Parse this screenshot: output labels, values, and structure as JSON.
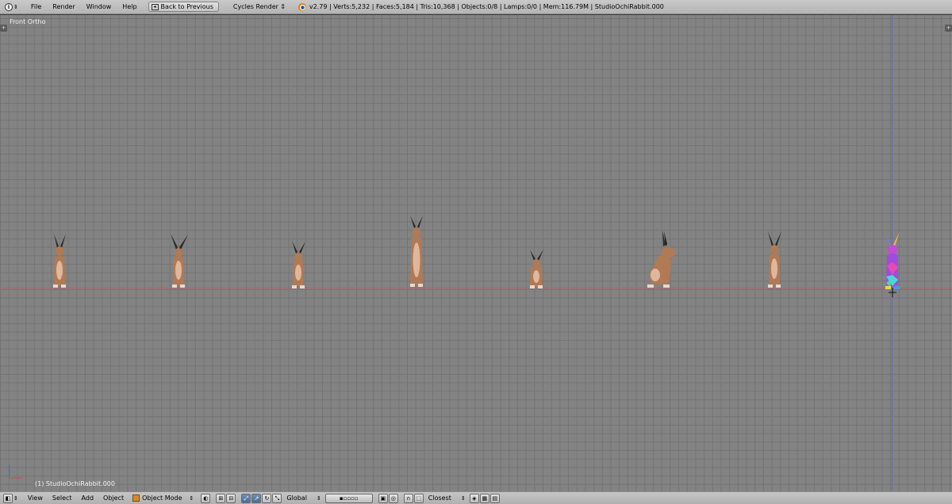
{
  "topbar": {
    "menus": [
      "File",
      "Render",
      "Window",
      "Help"
    ],
    "back_button": "Back to Previous",
    "render_engine": "Cycles Render",
    "stats": "v2.79 | Verts:5,232 | Faces:5,184 | Tris:10,368 | Objects:0/8 | Lamps:0/0 | Mem:116.79M | StudioOchiRabbit.000"
  },
  "viewport": {
    "view_name": "Front Ortho",
    "active_object_label": "(1) StudioOchiRabbit.000",
    "rabbit_count": 8
  },
  "bottombar": {
    "menus": [
      "View",
      "Select",
      "Add",
      "Object"
    ],
    "mode": "Object Mode",
    "orientation": "Global",
    "snap_target": "Closest"
  },
  "colors": {
    "viewport_bg": "#838383",
    "grid_line": "#747474",
    "x_axis": "#b46060",
    "z_axis": "#6a6ab0",
    "rabbit_fur": "#b07a55",
    "rabbit_belly": "#e0b69c",
    "rabbit_ear": "#2a2a2a"
  }
}
